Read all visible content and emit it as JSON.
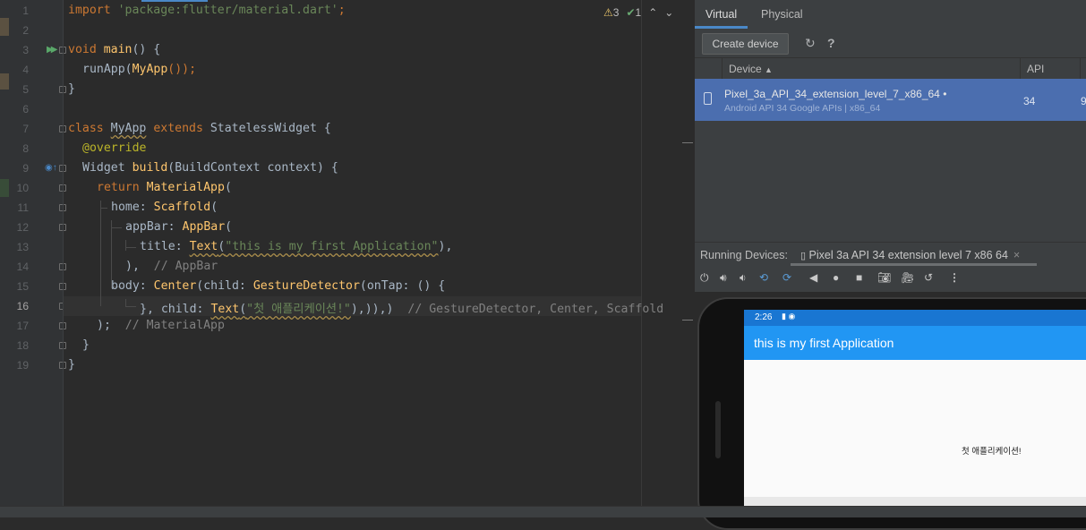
{
  "editor": {
    "line_numbers": [
      "1",
      "2",
      "3",
      "4",
      "5",
      "6",
      "7",
      "8",
      "9",
      "10",
      "11",
      "12",
      "13",
      "14",
      "15",
      "16",
      "17",
      "18",
      "19"
    ],
    "current_line": "16",
    "lines": {
      "l1_kw": "import",
      "l1_str": "'package:flutter/material.dart'",
      "l1_semi": ";",
      "l3_kw": "void",
      "l3_fn": "main",
      "l3_rest": "() {",
      "l4_a": "runApp(",
      "l4_fn": "MyApp",
      "l4_b": "());",
      "l5": "}",
      "l7_kw": "class",
      "l7_name": "MyApp",
      "l7_kw2": "extends",
      "l7_rest": "StatelessWidget {",
      "l8": "@override",
      "l9_a": "Widget",
      "l9_fn": "build",
      "l9_b": "(BuildContext context) {",
      "l10_kw": "return",
      "l10_fn": "MaterialApp",
      "l10_b": "(",
      "l11_a": "home:",
      "l11_fn": "Scaffold",
      "l11_b": "(",
      "l12_a": "appBar:",
      "l12_fn": "AppBar",
      "l12_b": "(",
      "l13_a": "title:",
      "l13_fn": "Text",
      "l13_b": "(",
      "l13_str": "\"this is my first Application\"",
      "l13_c": "),",
      "l14_a": "),",
      "l14_cm": "// AppBar",
      "l15_a": "body:",
      "l15_fn": "Center",
      "l15_b": "(child:",
      "l15_fn2": "GestureDetector",
      "l15_c": "(onTap: () {",
      "l16_a": "},",
      "l16_b": "child:",
      "l16_fn": "Text",
      "l16_c": "(",
      "l16_str": "\"첫 애플리케이션!\"",
      "l16_d": "),)),)",
      "l16_cm": "// GestureDetector, Center, Scaffold",
      "l17_a": ");",
      "l17_cm": "// MaterialApp",
      "l18": "}",
      "l19": "}"
    },
    "inspections": {
      "warnings": "3",
      "weak_warnings": "1"
    }
  },
  "device_manager": {
    "tabs": [
      "Virtual",
      "Physical"
    ],
    "active_tab": "Virtual",
    "create_button": "Create device",
    "refresh_icon": "↻",
    "help_icon": "?",
    "columns": {
      "device": "Device",
      "api": "API"
    },
    "sort_indicator": "▲",
    "device": {
      "name": "Pixel_3a_API_34_extension_level_7_x86_64",
      "status_dot": "•",
      "subtitle": "Android API 34 Google APIs | x86_64",
      "api": "34",
      "extra": "9"
    }
  },
  "running_devices": {
    "label": "Running Devices:",
    "tab": "Pixel 3a API 34 extension level 7 x86 64",
    "close": "×"
  },
  "emulator": {
    "time": "2:26",
    "app_title": "this is my first Application",
    "center_text": "첫 애플리케이션!"
  },
  "colors": {
    "accent": "#4a88c7",
    "selection": "#4b6eaf",
    "appbar": "#2196f3",
    "statusbar": "#1976d2"
  }
}
